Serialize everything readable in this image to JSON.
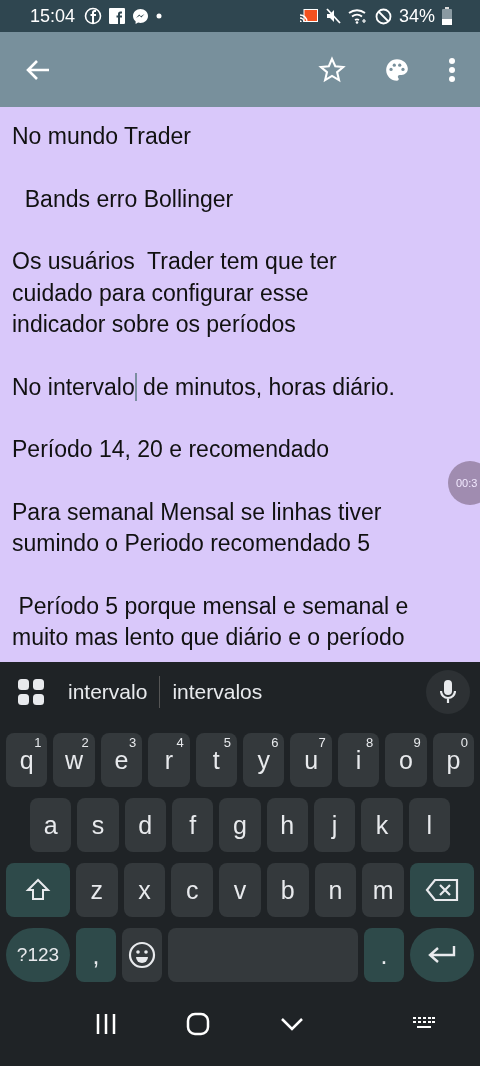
{
  "status_bar": {
    "time": "15:04",
    "battery": "34%"
  },
  "app_bar": {
    "starred": false
  },
  "note": {
    "paragraphs": [
      {
        "lines": [
          "No mundo Trader"
        ]
      },
      {
        "lines": [
          "  Bands erro Bollinger"
        ]
      },
      {
        "lines": [
          "Os usuários  Trader tem que ter",
          "cuidado para configurar esse",
          "indicador sobre os períodos"
        ]
      },
      {
        "lines": [
          {
            "before": "No intervalo",
            "after": " de minutos, horas diário."
          }
        ]
      },
      {
        "lines": [
          "Período 14, 20 e recomendado"
        ]
      },
      {
        "lines": [
          "Para semanal Mensal se linhas tiver",
          "sumindo o Periodo recomendado 5"
        ]
      },
      {
        "lines": [
          " Período 5 porque mensal e semanal e",
          "muito mas lento que diário e o período"
        ]
      }
    ]
  },
  "timer_bubble": "00:3",
  "keyboard": {
    "suggestions": [
      "intervalo",
      "intervalos"
    ],
    "rows": [
      {
        "keys": [
          {
            "kind": "letter",
            "label": "q",
            "hint": "1"
          },
          {
            "kind": "letter",
            "label": "w",
            "hint": "2"
          },
          {
            "kind": "letter",
            "label": "e",
            "hint": "3"
          },
          {
            "kind": "letter",
            "label": "r",
            "hint": "4"
          },
          {
            "kind": "letter",
            "label": "t",
            "hint": "5"
          },
          {
            "kind": "letter",
            "label": "y",
            "hint": "6"
          },
          {
            "kind": "letter",
            "label": "u",
            "hint": "7"
          },
          {
            "kind": "letter",
            "label": "i",
            "hint": "8"
          },
          {
            "kind": "letter",
            "label": "o",
            "hint": "9"
          },
          {
            "kind": "letter",
            "label": "p",
            "hint": "0"
          }
        ]
      },
      {
        "keys": [
          {
            "kind": "letter",
            "label": "a"
          },
          {
            "kind": "letter",
            "label": "s"
          },
          {
            "kind": "letter",
            "label": "d"
          },
          {
            "kind": "letter",
            "label": "f"
          },
          {
            "kind": "letter",
            "label": "g"
          },
          {
            "kind": "letter",
            "label": "h"
          },
          {
            "kind": "letter",
            "label": "j"
          },
          {
            "kind": "letter",
            "label": "k"
          },
          {
            "kind": "letter",
            "label": "l"
          }
        ]
      },
      {
        "keys": [
          {
            "kind": "shift"
          },
          {
            "kind": "letter",
            "label": "z"
          },
          {
            "kind": "letter",
            "label": "x"
          },
          {
            "kind": "letter",
            "label": "c"
          },
          {
            "kind": "letter",
            "label": "v"
          },
          {
            "kind": "letter",
            "label": "b"
          },
          {
            "kind": "letter",
            "label": "n"
          },
          {
            "kind": "letter",
            "label": "m"
          },
          {
            "kind": "backspace"
          }
        ]
      },
      {
        "keys": [
          {
            "kind": "symbols",
            "label": "?123"
          },
          {
            "kind": "punct",
            "label": ","
          },
          {
            "kind": "emoji"
          },
          {
            "kind": "space"
          },
          {
            "kind": "punct",
            "label": "."
          },
          {
            "kind": "enter"
          }
        ]
      }
    ]
  }
}
